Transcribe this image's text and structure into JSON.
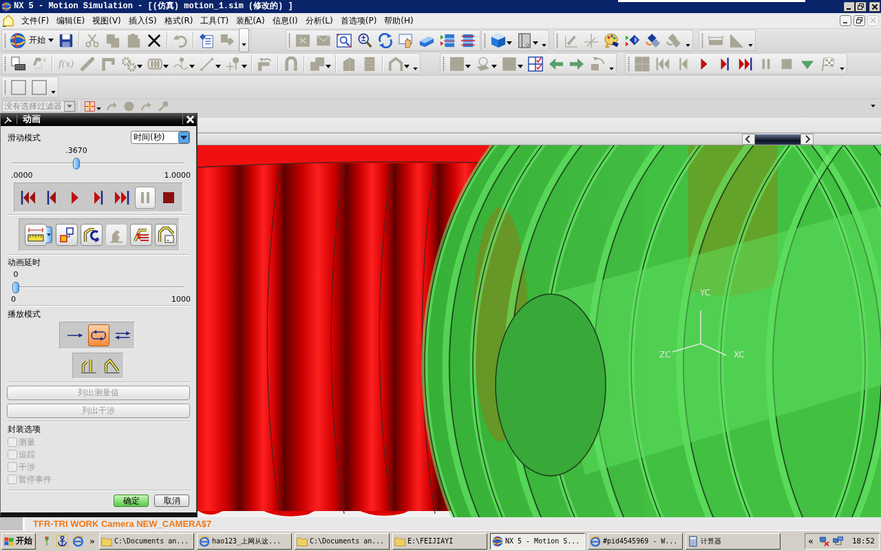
{
  "window": {
    "title": "NX 5 - Motion Simulation - [(仿真) motion_1.sim (修改的) ]"
  },
  "menu": [
    "文件(F)",
    "编辑(E)",
    "视图(V)",
    "插入(S)",
    "格式(R)",
    "工具(T)",
    "装配(A)",
    "信息(I)",
    "分析(L)",
    "首选项(P)",
    "帮助(H)"
  ],
  "mdi_controls": [
    {
      "kind": "minimize",
      "disabled": false
    },
    {
      "kind": "restore",
      "disabled": false
    },
    {
      "kind": "close",
      "disabled": true
    }
  ],
  "toolbar_rows": [
    [
      {
        "overflow": true,
        "groups": [
          [
            {
              "kind": "start",
              "label": "开始",
              "disabled": false,
              "dropdown": true
            },
            {
              "kind": "save",
              "disabled": false,
              "dropdown": false
            }
          ],
          [
            {
              "kind": "cut",
              "disabled": true,
              "dropdown": false
            },
            {
              "kind": "copy",
              "disabled": true,
              "dropdown": false
            },
            {
              "kind": "paste",
              "disabled": true,
              "dropdown": false
            },
            {
              "kind": "delete",
              "disabled": false,
              "dropdown": false
            }
          ],
          [
            {
              "kind": "undo",
              "disabled": true,
              "dropdown": false
            }
          ],
          [
            {
              "kind": "properties",
              "disabled": false,
              "dropdown": false
            },
            {
              "kind": "info",
              "disabled": true,
              "dropdown": false
            }
          ]
        ]
      },
      {
        "overflow": false,
        "groups": [
          [
            {
              "kind": "fit",
              "disabled": true,
              "dropdown": false
            },
            {
              "kind": "envelope",
              "disabled": true,
              "dropdown": false
            },
            {
              "kind": "zoom_window",
              "disabled": false,
              "dropdown": false
            },
            {
              "kind": "zoom",
              "disabled": false,
              "dropdown": false
            },
            {
              "kind": "rotate",
              "disabled": false,
              "dropdown": false
            },
            {
              "kind": "pan",
              "disabled": false,
              "dropdown": false
            },
            {
              "kind": "prism",
              "disabled": false,
              "dropdown": false
            },
            {
              "kind": "stack_play",
              "disabled": false,
              "dropdown": false
            },
            {
              "kind": "stack_lines",
              "disabled": false,
              "dropdown": false
            }
          ]
        ]
      },
      {
        "overflow": true,
        "groups": [
          [
            {
              "kind": "cube",
              "disabled": false,
              "dropdown": true
            },
            {
              "kind": "sheet",
              "disabled": false,
              "dropdown": true
            }
          ]
        ]
      },
      {
        "overflow": true,
        "groups": [
          [
            {
              "kind": "axes",
              "disabled": true,
              "dropdown": false
            },
            {
              "kind": "axes2",
              "disabled": true,
              "dropdown": false
            },
            {
              "kind": "palette",
              "disabled": false,
              "dropdown": false
            },
            {
              "kind": "diamond_play",
              "disabled": false,
              "dropdown": false
            },
            {
              "kind": "diamonds",
              "disabled": false,
              "dropdown": false
            },
            {
              "kind": "diamonds",
              "disabled": true,
              "dropdown": false
            }
          ]
        ]
      },
      {
        "overflow": true,
        "groups": [
          [
            {
              "kind": "ruler",
              "disabled": true,
              "dropdown": false
            },
            {
              "kind": "angle",
              "disabled": true,
              "dropdown": false
            }
          ]
        ]
      }
    ],
    [
      {
        "overflow": true,
        "groups": [
          [
            {
              "kind": "keyboard",
              "disabled": false,
              "dropdown": false
            },
            {
              "kind": "point_move",
              "disabled": true,
              "dropdown": false
            }
          ],
          [
            {
              "kind": "function",
              "label": "f(x)",
              "disabled": true,
              "dropdown": false
            },
            {
              "kind": "link",
              "disabled": true,
              "dropdown": false
            },
            {
              "kind": "bent_link",
              "disabled": true,
              "dropdown": false
            },
            {
              "kind": "gears",
              "disabled": true,
              "dropdown": true
            },
            {
              "kind": "spring",
              "disabled": true,
              "dropdown": true
            },
            {
              "kind": "curve",
              "disabled": true,
              "dropdown": true
            },
            {
              "kind": "line_arrow",
              "disabled": true,
              "dropdown": true
            },
            {
              "kind": "pin",
              "disabled": true,
              "dropdown": true
            }
          ],
          [
            {
              "kind": "joint",
              "disabled": true,
              "dropdown": false
            }
          ],
          [
            {
              "kind": "hook",
              "disabled": true,
              "dropdown": false
            }
          ],
          [
            {
              "kind": "boxes",
              "disabled": true,
              "dropdown": true
            }
          ],
          [
            {
              "kind": "block",
              "disabled": true,
              "dropdown": false
            },
            {
              "kind": "panel",
              "disabled": true,
              "dropdown": false
            }
          ],
          [
            {
              "kind": "arch",
              "disabled": true,
              "dropdown": true
            }
          ]
        ]
      },
      {
        "overflow": true,
        "groups": [
          [
            {
              "kind": "graph",
              "disabled": true,
              "dropdown": true
            },
            {
              "kind": "tag_circle",
              "disabled": true,
              "dropdown": true
            },
            {
              "kind": "square",
              "disabled": true,
              "dropdown": true
            },
            {
              "kind": "checklist",
              "disabled": false,
              "dropdown": false
            },
            {
              "kind": "arrow_left",
              "disabled": false,
              "dropdown": false
            },
            {
              "kind": "arrow_right",
              "disabled": false,
              "dropdown": false
            },
            {
              "kind": "reset",
              "disabled": true,
              "dropdown": false
            }
          ]
        ]
      },
      {
        "overflow": true,
        "groups": [
          [
            {
              "kind": "grid",
              "disabled": true,
              "dropdown": false
            },
            {
              "kind": "skip_start",
              "disabled": true,
              "dropdown": false
            },
            {
              "kind": "step_back",
              "disabled": true,
              "dropdown": false
            },
            {
              "kind": "play",
              "disabled": false,
              "dropdown": false
            },
            {
              "kind": "step_forward",
              "disabled": false,
              "dropdown": false
            },
            {
              "kind": "fast_forward",
              "disabled": false,
              "dropdown": false
            },
            {
              "kind": "pause",
              "disabled": true,
              "dropdown": false
            },
            {
              "kind": "stop",
              "disabled": true,
              "dropdown": false
            },
            {
              "kind": "down",
              "disabled": false,
              "dropdown": false
            },
            {
              "kind": "flag",
              "disabled": true,
              "dropdown": false
            }
          ]
        ]
      }
    ],
    [
      {
        "overflow": true,
        "groups": [
          [
            {
              "kind": "blank",
              "disabled": false,
              "dropdown": false
            },
            {
              "kind": "blank",
              "disabled": false,
              "dropdown": false
            }
          ]
        ]
      }
    ]
  ],
  "filter_bar": {
    "filter": "没有选择过滤器",
    "disabled": true,
    "tools": [
      {
        "kind": "target",
        "disabled": false,
        "dropdown": true
      },
      {
        "kind": "curved_arrow",
        "disabled": true,
        "dropdown": false
      },
      {
        "kind": "sphere",
        "disabled": true,
        "dropdown": false
      },
      {
        "kind": "curved_arrow",
        "disabled": true,
        "dropdown": false
      },
      {
        "kind": "wrench",
        "disabled": true,
        "dropdown": false
      }
    ]
  },
  "dialog": {
    "title": "动画",
    "slide_mode": {
      "label": "滑动模式",
      "value": "时间(秒)"
    },
    "time_slider": {
      "value": ".3670",
      "min": ".0000",
      "max": "1.0000",
      "level": 0.367
    },
    "playback": [
      {
        "kind": "skip_start",
        "disabled": false,
        "selected": false
      },
      {
        "kind": "step_back",
        "disabled": false,
        "selected": false
      },
      {
        "kind": "play",
        "disabled": false,
        "selected": false
      },
      {
        "kind": "step_forward",
        "disabled": false,
        "selected": false
      },
      {
        "kind": "fast_forward",
        "disabled": false,
        "selected": false
      },
      {
        "kind": "pause",
        "disabled": true,
        "selected": true
      },
      {
        "kind": "stop",
        "disabled": false,
        "selected": false
      }
    ],
    "tools": [
      {
        "kind": "measure",
        "disabled": false,
        "dropdown": true
      },
      {
        "kind": "squares",
        "disabled": false,
        "dropdown": false
      },
      {
        "kind": "linkage_arrow",
        "disabled": false,
        "dropdown": false
      },
      {
        "kind": "figure",
        "disabled": true,
        "dropdown": false
      },
      {
        "kind": "red_arrows",
        "disabled": false,
        "dropdown": false
      },
      {
        "kind": "linkage_box",
        "disabled": false,
        "dropdown": false
      }
    ],
    "delay": {
      "label": "动画延时",
      "value": "0",
      "min": "0",
      "max": "1000",
      "level": 0
    },
    "play_mode": {
      "label": "播放模式",
      "modes": [
        {
          "kind": "once",
          "selected": false
        },
        {
          "kind": "loop",
          "selected": true
        },
        {
          "kind": "pingpong",
          "selected": false
        }
      ]
    },
    "linkage_modes": [
      {
        "kind": "link_bent"
      },
      {
        "kind": "link_angle"
      }
    ],
    "buttons": [
      {
        "label": "列出测量值",
        "disabled": true
      },
      {
        "label": "列出干涉",
        "disabled": true
      }
    ],
    "package_options": {
      "label": "封装选项",
      "items": [
        {
          "label": "测量",
          "checked": false,
          "disabled": true
        },
        {
          "label": "追踪",
          "checked": false,
          "disabled": true
        },
        {
          "label": "干涉",
          "checked": false,
          "disabled": true
        },
        {
          "label": "暂停事件",
          "checked": false,
          "disabled": true
        }
      ]
    },
    "actions": [
      {
        "label": "确定",
        "kind": "default"
      },
      {
        "label": "取消",
        "kind": "normal"
      }
    ]
  },
  "viewport": {
    "axis_labels": [
      {
        "kind": "y",
        "text": "YC"
      },
      {
        "kind": "z",
        "text": "ZC"
      },
      {
        "kind": "x",
        "text": "XC"
      }
    ],
    "camera_label": "TFR-TRI WORK Camera NEW_CAMERA$7"
  },
  "taskbar": {
    "start": "开始",
    "more": "»",
    "tasks": [
      {
        "kind": "folder",
        "label": "C:\\Documents an...",
        "selected": false
      },
      {
        "kind": "browser",
        "label": "hao123_上网从这...",
        "selected": false
      },
      {
        "kind": "folder",
        "label": "C:\\Documents an...",
        "selected": false
      },
      {
        "kind": "folder",
        "label": "E:\\FEIJIAYI",
        "selected": false
      },
      {
        "kind": "app",
        "label": "NX 5 - Motion S...",
        "selected": true
      },
      {
        "kind": "browser",
        "label": "#pid4545969 - W...",
        "selected": false
      },
      {
        "kind": "calculator",
        "label": "计算器",
        "selected": false
      }
    ],
    "tray_toggle": "«",
    "time": "18:52"
  }
}
